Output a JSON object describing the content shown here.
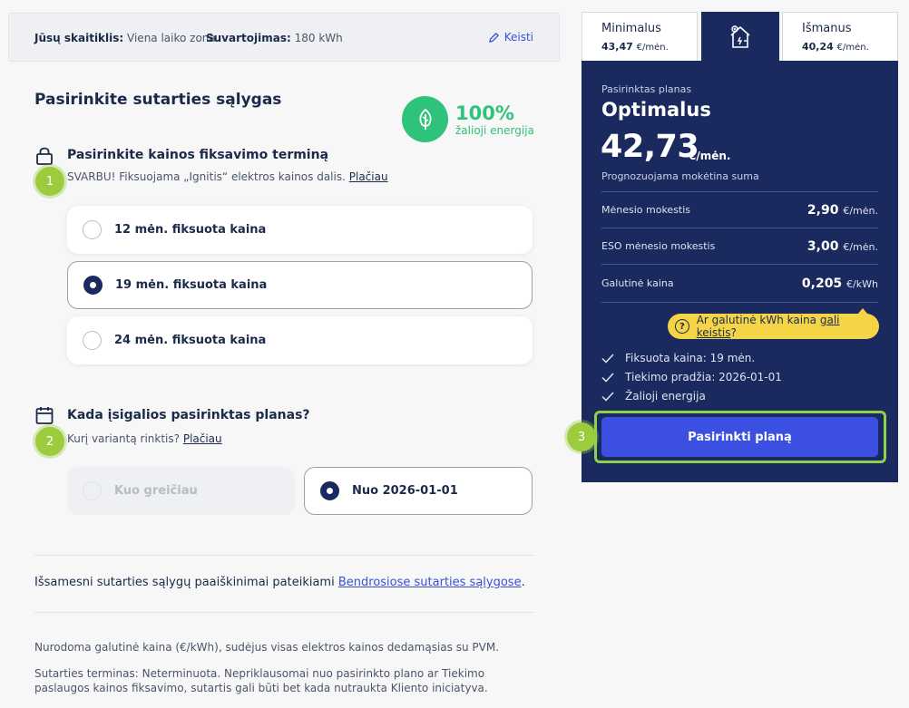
{
  "meter": {
    "meter_label": "Jūsų skaitiklis:",
    "meter_value": "Viena laiko zona",
    "usage_label": "Suvartojimas:",
    "usage_value": "180 kWh",
    "change_label": "Keisti"
  },
  "main": {
    "title": "Pasirinkite sutarties sąlygas",
    "green": {
      "percent": "100%",
      "label": "žalioji energija"
    },
    "fixation": {
      "title": "Pasirinkite kainos fiksavimo terminą",
      "note": "SVARBU! Fiksuojama „Ignitis“ elektros kainos dalis.",
      "note_link": "Plačiau",
      "options": [
        {
          "label": "12 mėn. fiksuota kaina",
          "selected": false
        },
        {
          "label": "19 mėn. fiksuota kaina",
          "selected": true
        },
        {
          "label": "24 mėn. fiksuota kaina",
          "selected": false
        }
      ]
    },
    "start": {
      "title": "Kada įsigalios pasirinktas planas?",
      "note": "Kurį variantą rinktis?",
      "note_link": "Plačiau",
      "options": [
        {
          "label": "Kuo greičiau",
          "selected": false,
          "disabled": true
        },
        {
          "label": "Nuo 2026-01-01",
          "selected": true,
          "disabled": false
        }
      ]
    },
    "terms_text": "Išsamesni sutarties sąlygų paaiškinimai pateikiami",
    "terms_link": "Bendrosiose sutarties sąlygose",
    "terms_end": ".",
    "footnote_1": "Nurodoma galutinė kaina (€/kWh), sudėjus visas elektros kainos dedamąsias su PVM.",
    "footnote_2": "Sutarties terminas: Neterminuota. Nepriklausomai nuo pasirinkto plano ar Tiekimo paslaugos kainos fiksavimo, sutartis gali būti bet kada nutraukta Kliento iniciatyva."
  },
  "steps": [
    "1",
    "2",
    "3"
  ],
  "plans": {
    "tabs": [
      {
        "name": "Minimalus",
        "price": "43,47",
        "unit": "€/mėn."
      },
      {
        "name": "Optimalus",
        "icon": "house-energy-icon"
      },
      {
        "name": "Išmanus",
        "price": "40,24",
        "unit": "€/mėn."
      }
    ],
    "panel": {
      "label": "Pasirinktas planas",
      "name": "Optimalus",
      "price": "42,73",
      "price_unit": "€/mėn.",
      "price_note": "Prognozuojama mokėtina suma",
      "rows": [
        {
          "label": "Mėnesio mokestis",
          "value": "2,90",
          "unit": "€/mėn."
        },
        {
          "label": "ESO mėnesio mokestis",
          "value": "3,00",
          "unit": "€/mėn."
        },
        {
          "label": "Galutinė kaina",
          "value": "0,205",
          "unit": "€/kWh"
        }
      ],
      "tooltip_text": "Ar galutinė kWh kaina",
      "tooltip_link": "gali keistis",
      "tooltip_end": "?",
      "features": [
        "Fiksuota kaina: 19 mėn.",
        "Tiekimo pradžia: 2026-01-01",
        "Žalioji energija"
      ],
      "cta": "Pasirinkti planą"
    }
  },
  "colors": {
    "navy": "#1b2a5e",
    "accent_blue": "#3b4fe0",
    "green": "#2fc27a",
    "step_green": "#9ccc3d",
    "highlight_yellow": "#f5d547"
  }
}
